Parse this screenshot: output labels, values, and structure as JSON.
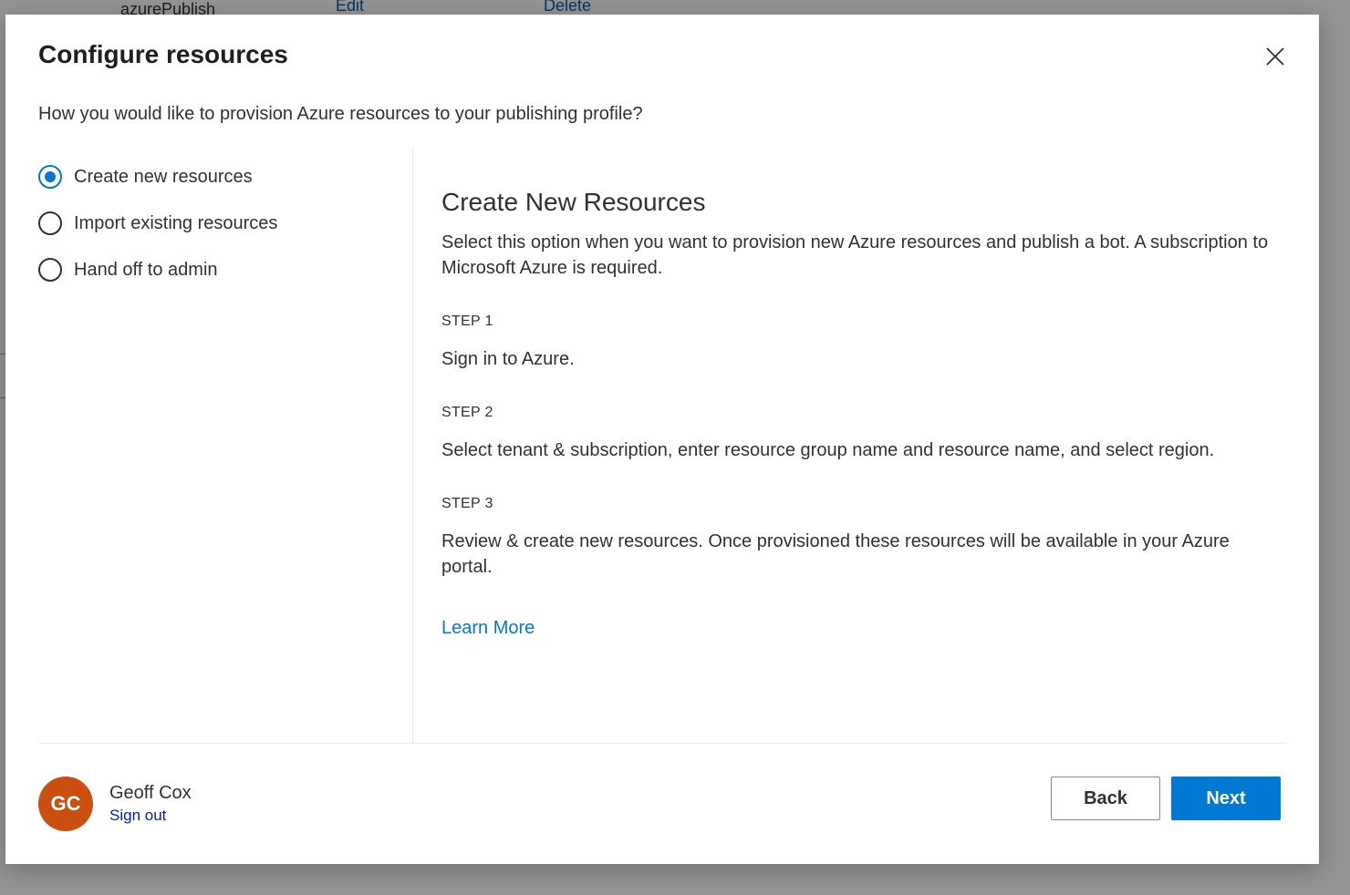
{
  "background": {
    "row_name": "azurePublish",
    "edit_label": "Edit",
    "delete_label": "Delete"
  },
  "dialog": {
    "title": "Configure resources",
    "subtitle": "How you would like to provision Azure resources to your publishing profile?",
    "close_icon": "close-icon"
  },
  "options": [
    {
      "label": "Create new resources",
      "selected": true
    },
    {
      "label": "Import existing resources",
      "selected": false
    },
    {
      "label": "Hand off to admin",
      "selected": false
    }
  ],
  "content": {
    "heading": "Create New Resources",
    "description": "Select this option when you want to provision new Azure resources and publish a bot. A subscription to Microsoft Azure is required.",
    "steps": [
      {
        "label": "STEP 1",
        "text": "Sign in to Azure."
      },
      {
        "label": "STEP 2",
        "text": "Select tenant & subscription, enter resource group name and resource name, and select region."
      },
      {
        "label": "STEP 3",
        "text": "Review & create new resources. Once provisioned these resources will be available in your Azure portal."
      }
    ],
    "learn_more": "Learn More"
  },
  "user": {
    "initials": "GC",
    "name": "Geoff Cox",
    "sign_out": "Sign out"
  },
  "footer": {
    "back_label": "Back",
    "next_label": "Next"
  },
  "colors": {
    "accent": "#0078d4",
    "avatar": "#ca5010"
  }
}
